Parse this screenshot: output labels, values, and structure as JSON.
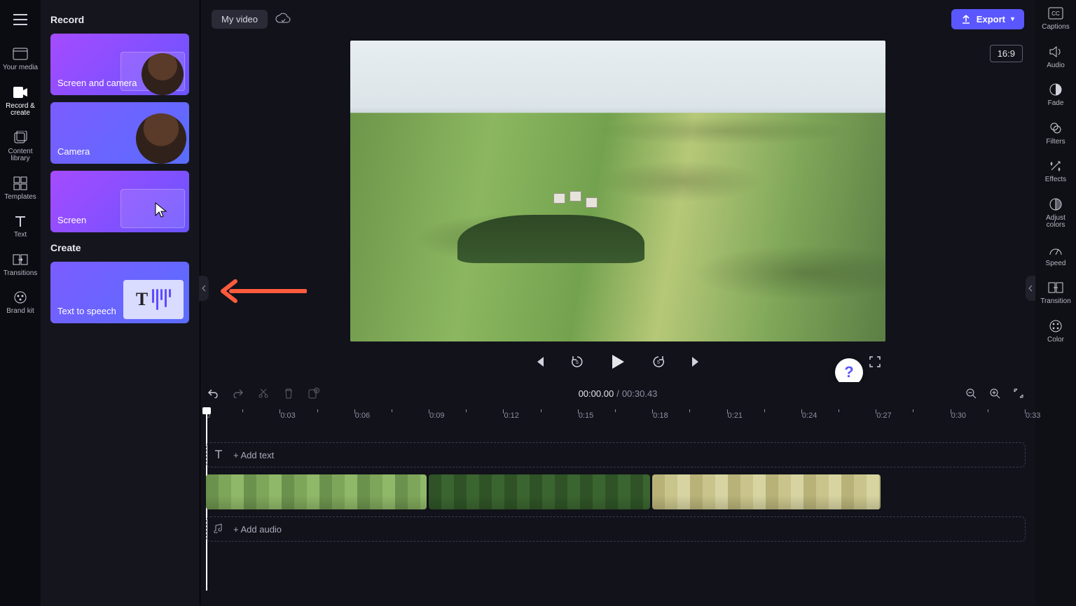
{
  "rail": {
    "items": [
      {
        "label": "Your media"
      },
      {
        "label": "Record & create",
        "active": true
      },
      {
        "label": "Content library"
      },
      {
        "label": "Templates"
      },
      {
        "label": "Text"
      },
      {
        "label": "Transitions"
      },
      {
        "label": "Brand kit"
      }
    ]
  },
  "panel": {
    "record_heading": "Record",
    "create_heading": "Create",
    "cards": {
      "screen_and_camera": "Screen and camera",
      "camera": "Camera",
      "screen": "Screen",
      "text_to_speech": "Text to speech"
    }
  },
  "topbar": {
    "title": "My video",
    "export": "Export"
  },
  "stage": {
    "aspect": "16:9"
  },
  "timeline": {
    "current": "00:00.00",
    "separator": "/",
    "total": "00:30.43",
    "ticks": [
      "0",
      "0:03",
      "0:06",
      "0:09",
      "0:12",
      "0:15",
      "0:18",
      "0:21",
      "0:24",
      "0:27",
      "0:30",
      "0:33"
    ],
    "add_text": "+ Add text",
    "add_audio": "+ Add audio"
  },
  "right_rail": {
    "items": [
      {
        "label": "Captions"
      },
      {
        "label": "Audio"
      },
      {
        "label": "Fade"
      },
      {
        "label": "Filters"
      },
      {
        "label": "Effects"
      },
      {
        "label": "Adjust colors"
      },
      {
        "label": "Speed"
      },
      {
        "label": "Transition"
      },
      {
        "label": "Color"
      }
    ]
  },
  "help": "?"
}
